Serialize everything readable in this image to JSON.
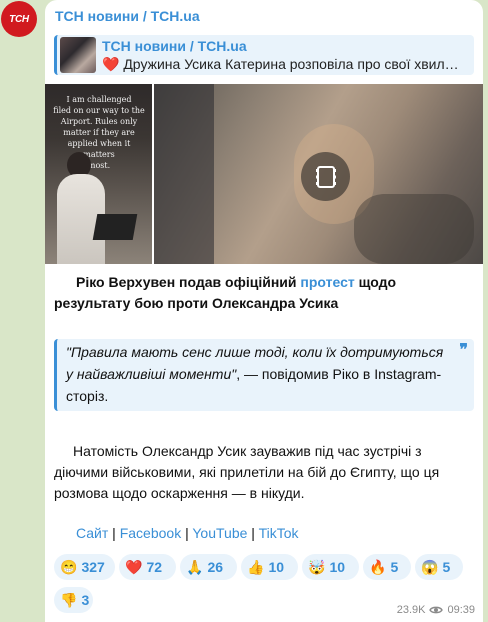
{
  "channel": {
    "name": "ТСН новини / TCH.ua",
    "avatar_text": "ТСН"
  },
  "reply": {
    "title": "ТСН новини / TCH.ua",
    "heart": "❤️",
    "text": "Дружина Усика Катерина розповіла про свої хвил…"
  },
  "media": {
    "sign_text": "I am challenged\nfiled on our way to the\nAirport. Rules only\nmatter if they are\napplied when it matters\nmost."
  },
  "post": {
    "para1_before": "Ріко Верхувен подав офіційний ",
    "para1_link": "протест",
    "para1_after": " щодо результату бою проти Олександра Усика",
    "quote_italic": "\"Правила мають сенс лише тоді, коли їх дотримуються у найважливіші моменти\"",
    "quote_rest": ", — повідомив Ріко в Instagram-сторіз.",
    "quote_icon": "❞",
    "para2": "Натомість Олександр Усик зауважив під час зустрічі з діючими військовими, які прилетіли на бій до Єгипту, що ця розмова щодо оскарження — в нікуди."
  },
  "links": {
    "site": "Сайт",
    "facebook": "Facebook",
    "youtube": "YouTube",
    "tiktok": "TikTok",
    "sep": " | "
  },
  "reactions": [
    {
      "emoji": "😁",
      "count": "327"
    },
    {
      "emoji": "❤️",
      "count": "72"
    },
    {
      "emoji": "🙏",
      "count": "26"
    },
    {
      "emoji": "👍",
      "count": "10"
    },
    {
      "emoji": "🤯",
      "count": "10"
    },
    {
      "emoji": "🔥",
      "count": "5"
    },
    {
      "emoji": "😱",
      "count": "5"
    },
    {
      "emoji": "👎",
      "count": "3"
    }
  ],
  "footer": {
    "views": "23.9K",
    "time": "09:39"
  }
}
